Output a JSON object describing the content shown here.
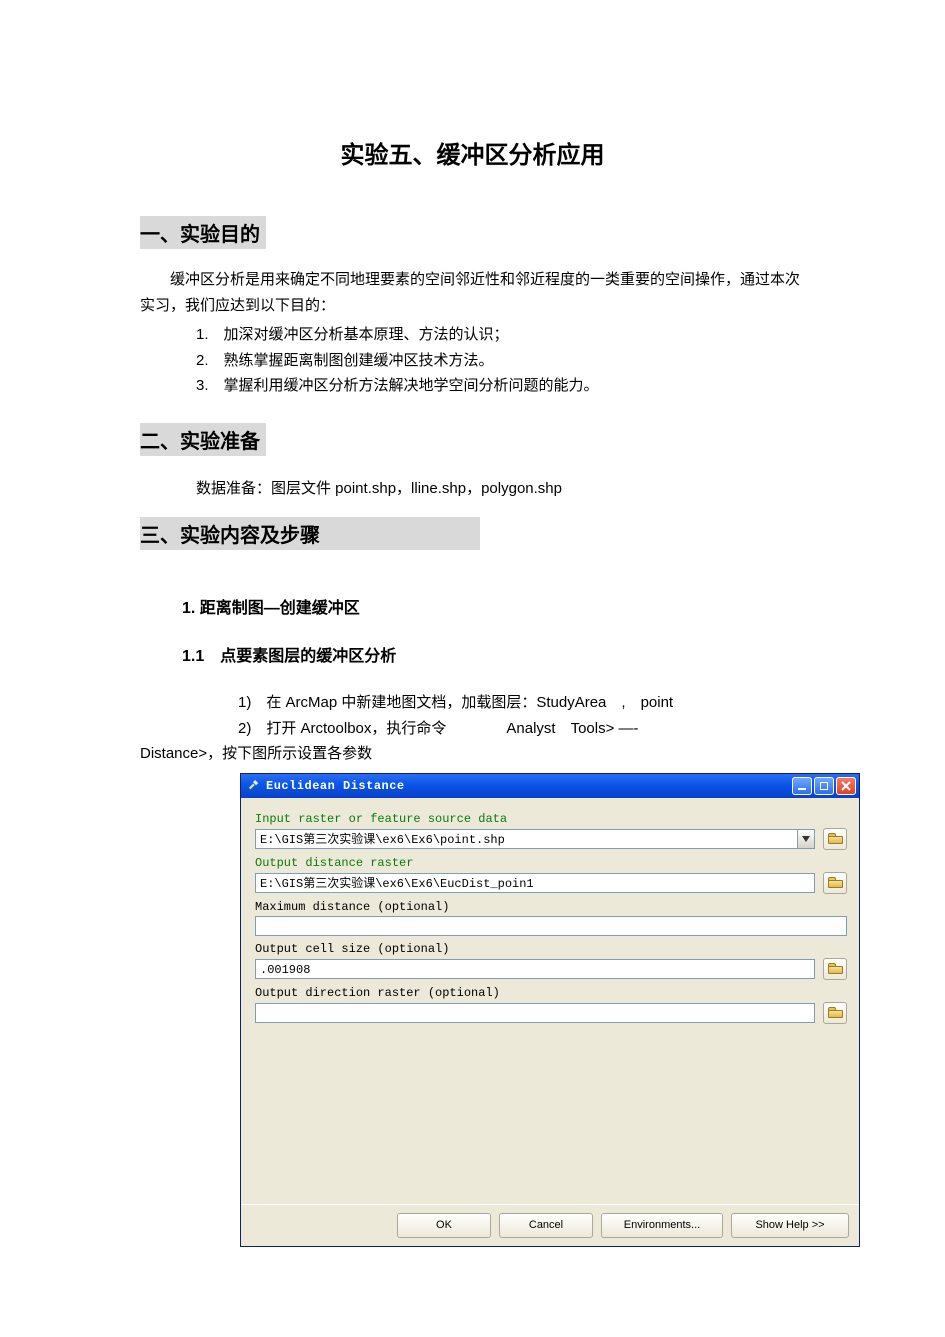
{
  "title": "实验五、缓冲区分析应用",
  "sections": {
    "s1": {
      "heading": "一、实验目的"
    },
    "s2": {
      "heading": "二、实验准备"
    },
    "s3": {
      "heading": "三、实验内容及步骤"
    }
  },
  "intro": "缓冲区分析是用来确定不同地理要素的空间邻近性和邻近程度的一类重要的空间操作，通过本次实习，我们应达到以下目的：",
  "goals": [
    "1.　加深对缓冲区分析基本原理、方法的认识；",
    "2.　熟练掌握距离制图创建缓冲区技术方法。",
    "3.　掌握利用缓冲区分析方法解决地学空间分析问题的能力。"
  ],
  "prep": "数据准备：图层文件 point.shp，lline.shp，polygon.shp",
  "sub1": "1. 距离制图—创建缓冲区",
  "sub1_1": "1.1　点要素图层的缓冲区分析",
  "steps": {
    "l1": "1)　在 ArcMap 中新建地图文档，加载图层：StudyArea　,　point",
    "l2": "2)　打开 Arctoolbox，执行命令　　　　Analyst　Tools> —-",
    "l3": "Distance>，按下图所示设置各参数"
  },
  "dialog": {
    "title": "Euclidean Distance",
    "labels": {
      "input": "Input raster or feature source data",
      "out_dist": "Output distance raster",
      "max_dist": "Maximum distance (optional)",
      "cell_size": "Output cell size (optional)",
      "out_dir": "Output direction raster (optional)"
    },
    "values": {
      "input": "E:\\GIS第三次实验课\\ex6\\Ex6\\point.shp",
      "out_dist": "E:\\GIS第三次实验课\\ex6\\Ex6\\EucDist_poin1",
      "max_dist": "",
      "cell_size": ".001908",
      "out_dir": ""
    },
    "buttons": {
      "ok": "OK",
      "cancel": "Cancel",
      "env": "Environments...",
      "help": "Show Help >>"
    }
  }
}
